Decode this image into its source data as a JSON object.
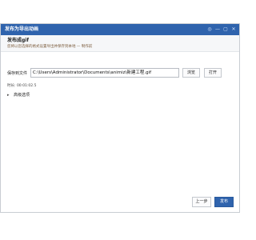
{
  "window": {
    "title": "发布为导出动画",
    "controls": [
      "◎",
      "—",
      "▢",
      "✕"
    ]
  },
  "header": {
    "title": "发布成gif",
    "subtitle": "您将以您选择的格式设置导出并保存到本地 — 制作前"
  },
  "export": {
    "label": "保存到文件",
    "path_value": "C:\\Users\\Administrator\\Documents\\animiz\\新建工程.gif",
    "browse_label": "浏览",
    "open_label": "打开"
  },
  "duration": "时长: 00:01:02.5",
  "advanced": {
    "arrow": "▸",
    "label": "高级选项"
  },
  "footer": {
    "prev_label": "上一步",
    "publish_label": "发布"
  },
  "colors": {
    "accent": "#2f63ad",
    "subtitle": "#7a5a3a"
  }
}
